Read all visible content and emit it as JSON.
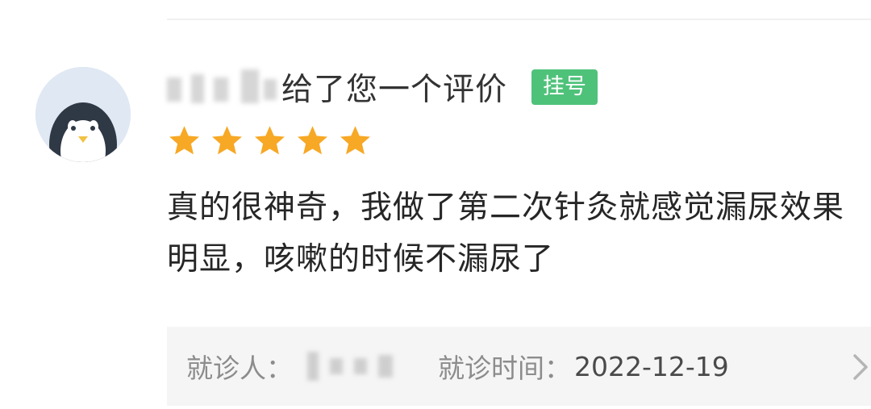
{
  "review": {
    "reviewer_suffix": "给了您一个评价",
    "badge": "挂号",
    "rating": 5,
    "max_rating": 5,
    "text": "真的很神奇，我做了第二次针灸就感觉漏尿效果明显，咳嗽的时候不漏尿了"
  },
  "footer": {
    "patient_label": "就诊人：",
    "visit_time_label": "就诊时间：",
    "visit_date": "2022-12-19"
  },
  "icons": {
    "avatar": "penguin-avatar-icon",
    "star": "star-icon",
    "chevron": "chevron-right-icon"
  },
  "colors": {
    "star": "#f7a825",
    "badge": "#4fc27a",
    "footer_bg": "#f5f5f5",
    "avatar_bg": "#dfe8f3"
  }
}
